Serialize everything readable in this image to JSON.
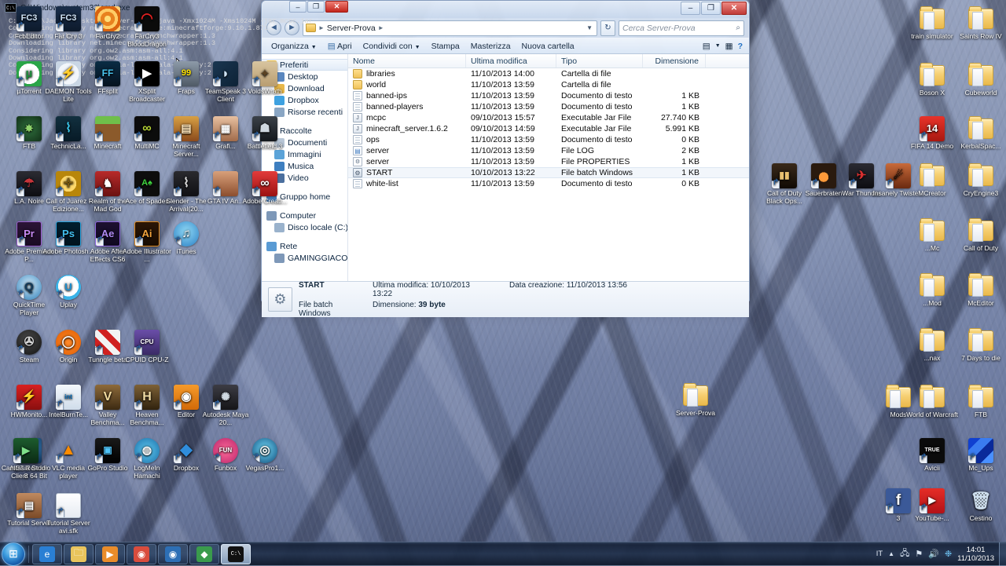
{
  "desktop": {
    "icons_left": [
      {
        "label": "FcbEditor",
        "icon": "farcry3-editor-icon",
        "style": "fc3"
      },
      {
        "label": "Far Cry 3",
        "icon": "farcry3-icon",
        "style": "fc3"
      },
      {
        "label": "FarCry2",
        "icon": "farcry2-icon",
        "style": "spiral"
      },
      {
        "label": "FarCry3 BloodDragon",
        "icon": "blooddragon-icon",
        "style": "bd"
      },
      {
        "label": "µTorrent",
        "icon": "utorrent-icon",
        "style": "utorrent"
      },
      {
        "label": "DAEMON Tools Lite",
        "icon": "daemon-tools-icon",
        "style": "daemon"
      },
      {
        "label": "FFsplit",
        "icon": "ffsplit-icon",
        "style": "ffsplit"
      },
      {
        "label": "XSplit Broadcaster",
        "icon": "xsplit-icon",
        "style": "xsplit"
      },
      {
        "label": "Fraps",
        "icon": "fraps-icon",
        "style": "fraps"
      },
      {
        "label": "TeamSpeak 3 Client",
        "icon": "teamspeak-icon",
        "style": "teamspeak"
      },
      {
        "label": "VoidsWrath",
        "icon": "voidswrath-icon",
        "style": "voids"
      },
      {
        "label": "FTB",
        "icon": "feedthebeast-icon",
        "style": "ftb"
      },
      {
        "label": "TechnicLa...",
        "icon": "technic-launcher-icon",
        "style": "technic"
      },
      {
        "label": "Minecraft",
        "icon": "minecraft-icon",
        "style": "grass"
      },
      {
        "label": "MultiMC",
        "icon": "multimc-icon",
        "style": "multimc"
      },
      {
        "label": "Minecraft Server...",
        "icon": "minecraft-server-icon",
        "style": "mcserver"
      },
      {
        "label": "Grafi...",
        "icon": "grafica-icon",
        "style": "grafica"
      },
      {
        "label": "Battlefield 3",
        "icon": "battlefield3-icon",
        "style": "bf3"
      },
      {
        "label": "L.A. Noire",
        "icon": "lanoire-icon",
        "style": "lanoire"
      },
      {
        "label": "Call of Juarez - Edizione...",
        "icon": "callofjuarez-icon",
        "style": "juarez"
      },
      {
        "label": "Realm of the Mad God",
        "icon": "realmofthemadgod-icon",
        "style": "realm"
      },
      {
        "label": "Ace of Spades",
        "icon": "aceofspades-icon",
        "style": "aos"
      },
      {
        "label": "Slender - The Arrival(20...",
        "icon": "slender-icon",
        "style": "slender"
      },
      {
        "label": "GTA IV An...",
        "icon": "gta4-icon",
        "style": "gta"
      },
      {
        "label": "Adobe Creati...",
        "icon": "adobe-cc-icon",
        "style": "cc"
      },
      {
        "label": "Adobe Premiere P...",
        "icon": "adobe-premiere-icon",
        "style": "pr"
      },
      {
        "label": "Adobe Photosh...",
        "icon": "adobe-photoshop-icon",
        "style": "ps"
      },
      {
        "label": "Adobe After Effects CS6",
        "icon": "adobe-aftereffects-icon",
        "style": "ae"
      },
      {
        "label": "Adobe Illustrator ...",
        "icon": "adobe-illustrator-icon",
        "style": "ai"
      },
      {
        "label": "iTunes",
        "icon": "itunes-icon",
        "style": "itunes"
      },
      {
        "label": "QuickTime Player",
        "icon": "quicktime-icon",
        "style": "quicktime"
      },
      {
        "label": "Uplay",
        "icon": "uplay-icon",
        "style": "uplay"
      },
      {
        "label": "Steam",
        "icon": "steam-icon",
        "style": "steam"
      },
      {
        "label": "Origin",
        "icon": "origin-icon",
        "style": "origin"
      },
      {
        "label": "Tunngle beta",
        "icon": "tunngle-icon",
        "style": "tunngle"
      },
      {
        "label": "CPUID CPU-Z",
        "icon": "cpuz-icon",
        "style": "cpuz"
      },
      {
        "label": "HWMonito...",
        "icon": "hwmonitor-icon",
        "style": "hwmon"
      },
      {
        "label": "IntelBurnTe...",
        "icon": "intelburntest-icon",
        "style": "intel"
      },
      {
        "label": "Valley Benchma...",
        "icon": "valley-benchmark-icon",
        "style": "valley"
      },
      {
        "label": "Heaven Benchma...",
        "icon": "heaven-benchmark-icon",
        "style": "heaven"
      },
      {
        "label": "Editor",
        "icon": "editor-icon",
        "style": "editor"
      },
      {
        "label": "Autodesk Maya 20...",
        "icon": "maya-icon",
        "style": "maya"
      },
      {
        "label": "NET Render Client 64 Bit",
        "icon": "netrender-icon",
        "style": "netrender"
      },
      {
        "label": "VLC media player",
        "icon": "vlc-icon",
        "style": "vlc"
      },
      {
        "label": "GoPro Studio",
        "icon": "gopro-icon",
        "style": "gopro"
      },
      {
        "label": "LogMeIn Hamachi",
        "icon": "hamachi-icon",
        "style": "hamachi"
      },
      {
        "label": "Dropbox",
        "icon": "dropbox-icon",
        "style": "dropbox"
      },
      {
        "label": "Funbox",
        "icon": "funbox-icon",
        "style": "funbox"
      },
      {
        "label": "VegasPro1...",
        "icon": "vegaspro-icon",
        "style": "vegas"
      },
      {
        "label": "Camtasia Studio 8",
        "icon": "camtasia-icon",
        "style": "camtasia"
      },
      {
        "label": "Tutorial Server",
        "icon": "tutorial-server-icon",
        "style": "tutvid"
      },
      {
        "label": "Tutorial Server avi.sfk",
        "icon": "tutorial-server-avi-icon",
        "style": "page"
      }
    ],
    "icons_right": [
      {
        "label": "train simulator",
        "icon": "folder-icon",
        "style": "folder"
      },
      {
        "label": "Saints Row IV",
        "icon": "folder-icon",
        "style": "folder"
      },
      {
        "label": "Boson X",
        "icon": "folder-icon",
        "style": "folder"
      },
      {
        "label": "Cubeworld",
        "icon": "folder-icon",
        "style": "folder"
      },
      {
        "label": "FIFA 14 Demo",
        "icon": "fifa14-icon",
        "style": "fifa"
      },
      {
        "label": "KerbalSpac...",
        "icon": "folder-icon",
        "style": "folder"
      },
      {
        "label": "Call of Duty Black Ops...",
        "icon": "callofduty-blackops-icon",
        "style": "cod"
      },
      {
        "label": "Sauerbraten",
        "icon": "sauerbraten-icon",
        "style": "sauer"
      },
      {
        "label": "War Thunder",
        "icon": "warthunder-icon",
        "style": "warthunder"
      },
      {
        "label": "Insanely Twiste...",
        "icon": "insanely-twisted-icon",
        "style": "twisted"
      },
      {
        "label": "MCreator",
        "icon": "folder-icon",
        "style": "folder"
      },
      {
        "label": "CryEngine3",
        "icon": "folder-icon",
        "style": "folder"
      },
      {
        "label": "...Mc",
        "icon": "folder-icon",
        "style": "folder"
      },
      {
        "label": "Call of Duty",
        "icon": "folder-icon",
        "style": "folder"
      },
      {
        "label": "...Mod",
        "icon": "folder-icon",
        "style": "folder"
      },
      {
        "label": "McEditor",
        "icon": "folder-icon",
        "style": "folder"
      },
      {
        "label": "...nax",
        "icon": "folder-icon",
        "style": "folder"
      },
      {
        "label": "7 Days to die",
        "icon": "folder-icon",
        "style": "folder"
      },
      {
        "label": "Mods",
        "icon": "folder-icon",
        "style": "folder"
      },
      {
        "label": "World of Warcraft",
        "icon": "folder-icon",
        "style": "folder"
      },
      {
        "label": "FTB",
        "icon": "folder-icon",
        "style": "folder"
      },
      {
        "label": "Avicii",
        "icon": "avicii-icon",
        "style": "avicii"
      },
      {
        "label": "Mc_Ups",
        "icon": "mcups-icon",
        "style": "mcups"
      },
      {
        "label": "3",
        "icon": "facebook-icon",
        "style": "facebook"
      },
      {
        "label": "YouTube-...",
        "icon": "youtube-icon",
        "style": "youtube"
      },
      {
        "label": "Cestino",
        "icon": "recycle-bin-icon",
        "style": "bin"
      }
    ],
    "icons_center": [
      {
        "label": "Server-Prova",
        "icon": "folder-icon",
        "style": "folder"
      }
    ]
  },
  "explorer": {
    "window_title": "",
    "address": {
      "crumb_root": "Server-Prova",
      "dropdown": "▼",
      "refresh": "↻"
    },
    "search": {
      "placeholder": "Cerca Server-Prova",
      "magnifier": "⌕"
    },
    "toolbar": {
      "organize": "Organizza",
      "open": "Apri",
      "share": "Condividi con",
      "print": "Stampa",
      "burn": "Masterizza",
      "new_folder": "Nuova cartella",
      "view_icon": "▤",
      "preview_icon": "▦",
      "help_icon": "?"
    },
    "navpane": {
      "groups": [
        {
          "header": {
            "label": "Preferiti",
            "icon": "star-icon",
            "color": "#f5c542",
            "selected": true
          },
          "items": [
            {
              "label": "Desktop",
              "icon": "desktop-icon",
              "color": "#5a87bf"
            },
            {
              "label": "Download",
              "icon": "download-icon",
              "color": "#e8b84b"
            },
            {
              "label": "Dropbox",
              "icon": "dropbox-icon",
              "color": "#3ea1e0"
            },
            {
              "label": "Risorse recenti",
              "icon": "recent-places-icon",
              "color": "#8aa6c4"
            }
          ]
        },
        {
          "header": {
            "label": "Raccolte",
            "icon": "libraries-icon",
            "color": "#c9a24d",
            "selected": false
          },
          "items": [
            {
              "label": "Documenti",
              "icon": "documents-icon",
              "color": "#b8c6d6"
            },
            {
              "label": "Immagini",
              "icon": "pictures-icon",
              "color": "#5ba3d8"
            },
            {
              "label": "Musica",
              "icon": "music-icon",
              "color": "#3e7fc0"
            },
            {
              "label": "Video",
              "icon": "video-icon",
              "color": "#4b6f9e"
            }
          ]
        },
        {
          "header": {
            "label": "Gruppo home",
            "icon": "homegroup-icon",
            "color": "#4d86c4",
            "selected": false
          },
          "items": []
        },
        {
          "header": {
            "label": "Computer",
            "icon": "computer-icon",
            "color": "#7e98b8",
            "selected": false
          },
          "items": [
            {
              "label": "Disco locale (C:)",
              "icon": "hard-drive-icon",
              "color": "#9ab2cc"
            }
          ]
        },
        {
          "header": {
            "label": "Rete",
            "icon": "network-icon",
            "color": "#5a9bd4",
            "selected": false
          },
          "items": [
            {
              "label": "GAMINGGIACOMO",
              "icon": "computer-icon",
              "color": "#7e98b8"
            }
          ]
        }
      ]
    },
    "columns": [
      "Nome",
      "Ultima modifica",
      "Tipo",
      "Dimensione"
    ],
    "files": [
      {
        "name": "libraries",
        "modified": "11/10/2013 14:00",
        "type": "Cartella di file",
        "size": "",
        "icon": "folder-icon",
        "kind": "fld",
        "selected": false
      },
      {
        "name": "world",
        "modified": "11/10/2013 13:59",
        "type": "Cartella di file",
        "size": "",
        "icon": "folder-icon",
        "kind": "fld",
        "selected": false
      },
      {
        "name": "banned-ips",
        "modified": "11/10/2013 13:59",
        "type": "Documento di testo",
        "size": "1 KB",
        "icon": "text-document-icon",
        "kind": "doc",
        "selected": false
      },
      {
        "name": "banned-players",
        "modified": "11/10/2013 13:59",
        "type": "Documento di testo",
        "size": "1 KB",
        "icon": "text-document-icon",
        "kind": "doc",
        "selected": false
      },
      {
        "name": "mcpc",
        "modified": "09/10/2013 15:57",
        "type": "Executable Jar File",
        "size": "27.740 KB",
        "icon": "jar-file-icon",
        "kind": "jar",
        "selected": false
      },
      {
        "name": "minecraft_server.1.6.2",
        "modified": "09/10/2013 14:59",
        "type": "Executable Jar File",
        "size": "5.991 KB",
        "icon": "jar-file-icon",
        "kind": "jar",
        "selected": false
      },
      {
        "name": "ops",
        "modified": "11/10/2013 13:59",
        "type": "Documento di testo",
        "size": "0 KB",
        "icon": "text-document-icon",
        "kind": "doc",
        "selected": false
      },
      {
        "name": "server",
        "modified": "11/10/2013 13:59",
        "type": "File LOG",
        "size": "2 KB",
        "icon": "log-file-icon",
        "kind": "log",
        "selected": false
      },
      {
        "name": "server",
        "modified": "11/10/2013 13:59",
        "type": "File PROPERTIES",
        "size": "1 KB",
        "icon": "properties-file-icon",
        "kind": "prop",
        "selected": false
      },
      {
        "name": "START",
        "modified": "10/10/2013 13:22",
        "type": "File batch Windows",
        "size": "1 KB",
        "icon": "batch-file-icon",
        "kind": "bat",
        "selected": true
      },
      {
        "name": "white-list",
        "modified": "11/10/2013 13:59",
        "type": "Documento di testo",
        "size": "0 KB",
        "icon": "text-document-icon",
        "kind": "doc",
        "selected": false
      }
    ],
    "status": {
      "name": "START",
      "type": "File batch Windows",
      "modified_label": "Ultima modifica:",
      "modified_value": "10/10/2013 13:22",
      "created_label": "Data creazione:",
      "created_value": "11/10/2013 13:56",
      "size_label": "Dimensione:",
      "size_value": "39 byte"
    },
    "window_buttons": {
      "minimize": "–",
      "maximize": "❐",
      "close": "✕"
    }
  },
  "cmd": {
    "title": "C:\\Windows\\system32\\cmd.exe",
    "badge": "C:\\",
    "window_buttons": {
      "minimize": "–",
      "maximize": "❐",
      "close": "✕"
    },
    "scroll": {
      "up": "▲",
      "down": "▼",
      "thumb": "≡"
    },
    "output": "C:\\Users\\Jack98\\Desktop\\Server-Prova>java -Xmx1024M -Xms1024M -jar mcpc.jar\nConsidering library net.minecraftforge:minecraftforge:9.10.1.871\nConsidering library net.minecraft:launchwrapper:1.3\nDownloading library net.minecraft:launchwrapper:1.3\nConsidering library org.ow2.asm:asm-all:4.1\nDownloading library org.ow2.asm:asm-all:4.1\nConsidering library org.scala-lang:scala-library:2.10.2\nDownloading library org.scala-lang:scala-library:2.10.2"
  },
  "taskbar": {
    "start": "⊞",
    "buttons": [
      {
        "name": "internet-explorer",
        "glyph": "e",
        "color": "#2a7fd4"
      },
      {
        "name": "windows-explorer",
        "glyph": "🗀",
        "color": "#e9c45c"
      },
      {
        "name": "windows-media-player",
        "glyph": "▶",
        "color": "#e98c2a"
      },
      {
        "name": "google-chrome",
        "glyph": "◉",
        "color": "#d94c3d"
      },
      {
        "name": "camtasia-studio",
        "glyph": "◉",
        "color": "#2d6fb5"
      },
      {
        "name": "image-viewer",
        "glyph": "◆",
        "color": "#3a9b4c"
      },
      {
        "name": "command-prompt",
        "glyph": "C:\\",
        "color": "#111111",
        "active": true
      }
    ],
    "tray": {
      "language": "IT",
      "show_hidden": "▲",
      "network": "🖧",
      "flag": "⚑",
      "volume": "🔊",
      "extra": "❉",
      "time": "14:01",
      "date": "11/10/2013"
    }
  }
}
